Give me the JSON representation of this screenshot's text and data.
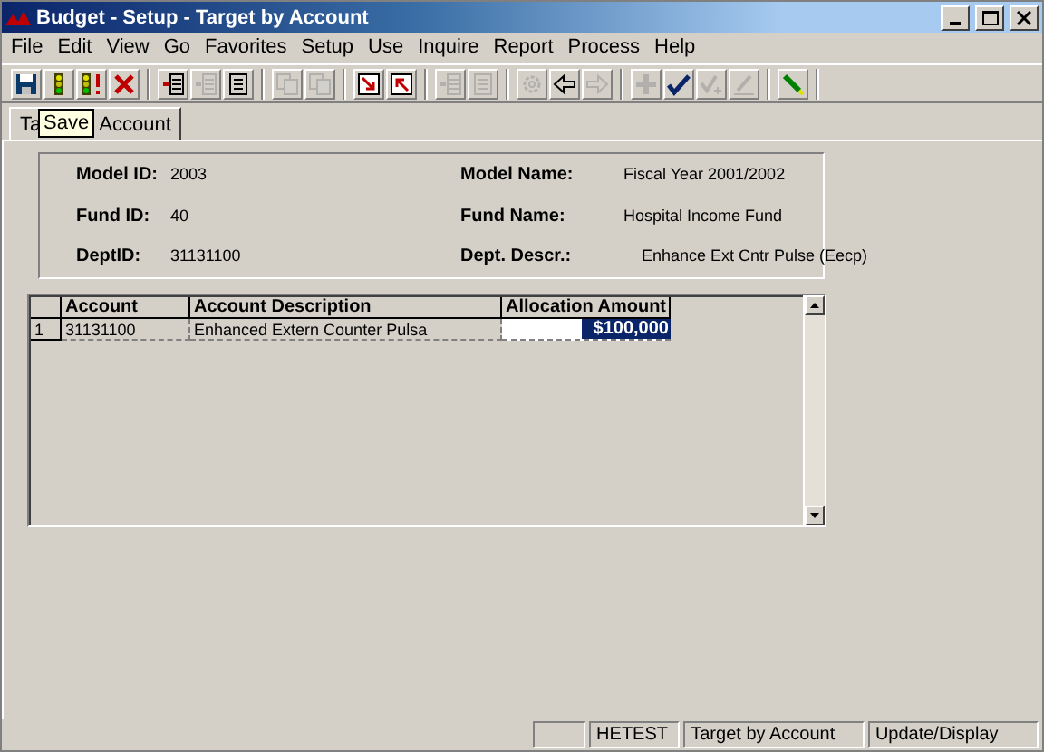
{
  "window": {
    "title": "Budget - Setup - Target by Account"
  },
  "menu": [
    "File",
    "Edit",
    "View",
    "Go",
    "Favorites",
    "Setup",
    "Use",
    "Inquire",
    "Report",
    "Process",
    "Help"
  ],
  "toolbar": [
    [
      {
        "kind": "save",
        "disabled": false
      },
      {
        "kind": "light",
        "disabled": false
      },
      {
        "kind": "light-alert",
        "disabled": false
      },
      {
        "kind": "delete",
        "disabled": false
      }
    ],
    [
      {
        "kind": "insert-row",
        "disabled": false
      },
      {
        "kind": "insert-row",
        "disabled": true
      },
      {
        "kind": "list",
        "disabled": false
      }
    ],
    [
      {
        "kind": "copy",
        "disabled": true
      },
      {
        "kind": "copy",
        "disabled": true
      }
    ],
    [
      {
        "kind": "arrow-down",
        "disabled": false
      },
      {
        "kind": "arrow-up",
        "disabled": false
      }
    ],
    [
      {
        "kind": "insert-row",
        "disabled": true
      },
      {
        "kind": "list",
        "disabled": true
      }
    ],
    [
      {
        "kind": "gear",
        "disabled": true
      },
      {
        "kind": "left",
        "disabled": false
      },
      {
        "kind": "right",
        "disabled": true
      }
    ],
    [
      {
        "kind": "plus",
        "disabled": true
      },
      {
        "kind": "check",
        "disabled": false
      },
      {
        "kind": "check-plus",
        "disabled": true
      },
      {
        "kind": "pencil",
        "disabled": true
      }
    ],
    [
      {
        "kind": "marker",
        "disabled": false
      }
    ]
  ],
  "tab": {
    "parts": [
      "Ta",
      "Account"
    ],
    "selected": true
  },
  "tooltip": "Save",
  "header": {
    "fields": [
      {
        "label": "Model ID:",
        "value": "2003"
      },
      {
        "label": "Model Name:",
        "value": "Fiscal Year 2001/2002"
      },
      {
        "label": "Fund ID:",
        "value": "40"
      },
      {
        "label": "Fund Name:",
        "value": "Hospital Income Fund"
      },
      {
        "label": "DeptID:",
        "value": "31131100"
      },
      {
        "label": "Dept. Descr.:",
        "value": "Enhance Ext Cntr Pulse (Eecp)"
      }
    ]
  },
  "table": {
    "columns": [
      "Account",
      "Account Description",
      "Allocation Amount"
    ],
    "rows": [
      {
        "number": "1",
        "account": "31131100",
        "description": "Enhanced Extern Counter Pulsa",
        "amount": "$100,000",
        "selected": true
      }
    ]
  },
  "status_bar": [
    "HETEST",
    "Target by Account",
    "Update/Display"
  ]
}
